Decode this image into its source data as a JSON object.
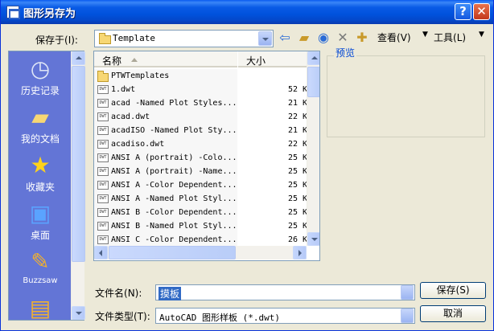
{
  "window": {
    "title": "图形另存为",
    "help_glyph": "?",
    "close_glyph": "✕"
  },
  "toolbar": {
    "save_in_label": "保存于",
    "save_in_key": "(I):",
    "save_in_value": "Template",
    "view_label": "查看",
    "view_key": "(V)",
    "tools_label": "工具",
    "tools_key": "(L)",
    "icons": [
      "back-arrow-icon",
      "up-folder-icon",
      "search-web-icon",
      "delete-icon",
      "new-folder-icon"
    ]
  },
  "places": [
    {
      "label": "历史记录",
      "icon": "history-icon"
    },
    {
      "label": "我的文档",
      "icon": "my-documents-icon"
    },
    {
      "label": "收藏夹",
      "icon": "favorites-star-icon"
    },
    {
      "label": "桌面",
      "icon": "desktop-icon"
    },
    {
      "label": "Buzzsaw",
      "icon": "buzzsaw-icon"
    }
  ],
  "filelist": {
    "col_name": "名称",
    "col_size": "大小",
    "rows": [
      {
        "name": "PTWTemplates",
        "size": "",
        "type": "folder"
      },
      {
        "name": "1.dwt",
        "size": "52 K",
        "type": "dwt"
      },
      {
        "name": "acad -Named Plot Styles...",
        "size": "21 K",
        "type": "dwt"
      },
      {
        "name": "acad.dwt",
        "size": "22 K",
        "type": "dwt"
      },
      {
        "name": "acadISO -Named Plot Sty...",
        "size": "21 K",
        "type": "dwt"
      },
      {
        "name": "acadiso.dwt",
        "size": "22 K",
        "type": "dwt"
      },
      {
        "name": "ANSI A (portrait) -Colo...",
        "size": "25 K",
        "type": "dwt"
      },
      {
        "name": "ANSI A (portrait) -Name...",
        "size": "25 K",
        "type": "dwt"
      },
      {
        "name": "ANSI A -Color Dependent...",
        "size": "25 K",
        "type": "dwt"
      },
      {
        "name": "ANSI A -Named Plot Styl...",
        "size": "25 K",
        "type": "dwt"
      },
      {
        "name": "ANSI B -Color Dependent...",
        "size": "25 K",
        "type": "dwt"
      },
      {
        "name": "ANSI B -Named Plot Styl...",
        "size": "25 K",
        "type": "dwt"
      },
      {
        "name": "ANSI C -Color Dependent...",
        "size": "26 K",
        "type": "dwt"
      }
    ]
  },
  "preview": {
    "label": "预览"
  },
  "filename": {
    "label": "文件名",
    "key": "(N):",
    "value": "摸板"
  },
  "filetype": {
    "label": "文件类型",
    "key": "(T):",
    "value": "AutoCAD 图形样板 (*.dwt)"
  },
  "buttons": {
    "save_label": "保存",
    "save_key": "(S)",
    "cancel_label": "取消"
  },
  "colors": {
    "titlebar": "#0052dc",
    "places_bg": "#6375d6",
    "selection": "#316ac5",
    "dialog_bg": "#ece9d8"
  }
}
